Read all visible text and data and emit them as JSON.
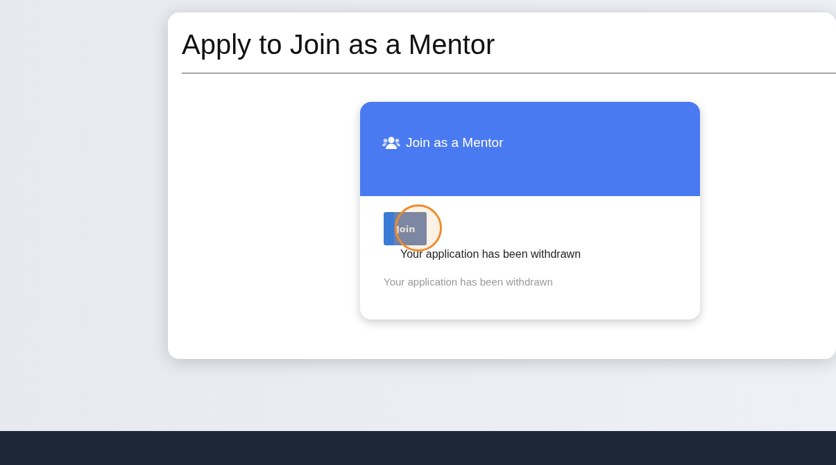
{
  "page": {
    "title": "Apply to Join as a Mentor"
  },
  "card": {
    "title": "Join as a Mentor",
    "button": "Join",
    "button_highlighted": true,
    "message": "Your application has been withdrawn",
    "note": "Your application has been withdrawn"
  }
}
